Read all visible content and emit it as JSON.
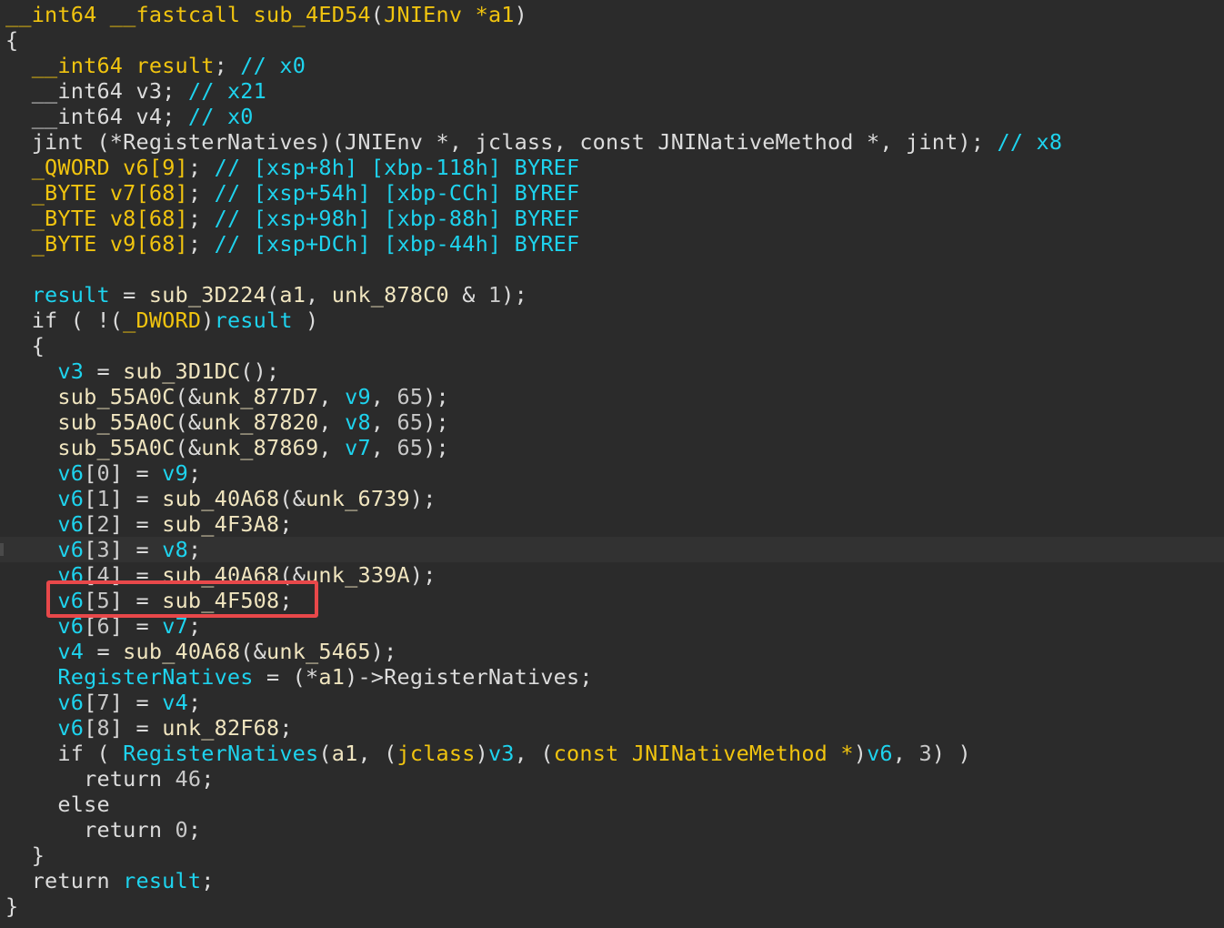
{
  "colors": {
    "background": "#2b2b2b",
    "type": "#f1c40f",
    "function": "#f0e5bf",
    "variable": "#1ed3ee",
    "comment": "#1ed3ee",
    "plain": "#dcdcdc",
    "number": "#c8c8c8",
    "highlight_box": "#e8484a"
  },
  "highlight": {
    "line_index": 23,
    "text": "v6[5] = sub_4F508;"
  },
  "code_lines": [
    {
      "indent": "",
      "tokens": [
        [
          "__int64",
          "type"
        ],
        [
          " ",
          "plain"
        ],
        [
          "__fastcall",
          "type"
        ],
        [
          " ",
          "plain"
        ],
        [
          "sub_4ED54",
          "type"
        ],
        [
          "(",
          "plain"
        ],
        [
          "JNIEnv",
          "type"
        ],
        [
          " ",
          "plain"
        ],
        [
          "*",
          "type"
        ],
        [
          "a1",
          "type"
        ],
        [
          ")",
          "plain"
        ]
      ]
    },
    {
      "indent": "",
      "tokens": [
        [
          "{",
          "plain"
        ]
      ]
    },
    {
      "indent": "  ",
      "tokens": [
        [
          "__int64",
          "type"
        ],
        [
          " ",
          "plain"
        ],
        [
          "result",
          "type"
        ],
        [
          ";",
          "plain"
        ],
        [
          " // x0",
          "comment"
        ]
      ]
    },
    {
      "indent": "  ",
      "tokens": [
        [
          "__int64",
          "plain"
        ],
        [
          " ",
          "plain"
        ],
        [
          "v3",
          "plain"
        ],
        [
          ";",
          "plain"
        ],
        [
          " // x21",
          "comment"
        ]
      ]
    },
    {
      "indent": "  ",
      "tokens": [
        [
          "__int64",
          "plain"
        ],
        [
          " ",
          "plain"
        ],
        [
          "v4",
          "plain"
        ],
        [
          ";",
          "plain"
        ],
        [
          " // x0",
          "comment"
        ]
      ]
    },
    {
      "indent": "  ",
      "tokens": [
        [
          "jint (*RegisterNatives)(JNIEnv *, jclass, const JNINativeMethod *, jint);",
          "plain"
        ],
        [
          " // x8",
          "comment"
        ]
      ]
    },
    {
      "indent": "  ",
      "tokens": [
        [
          "_QWORD",
          "type"
        ],
        [
          " ",
          "plain"
        ],
        [
          "v6[9]",
          "type"
        ],
        [
          ";",
          "plain"
        ],
        [
          " // [xsp+8h] [xbp-118h] BYREF",
          "comment"
        ]
      ]
    },
    {
      "indent": "  ",
      "tokens": [
        [
          "_BYTE",
          "type"
        ],
        [
          " ",
          "plain"
        ],
        [
          "v7[68]",
          "type"
        ],
        [
          ";",
          "plain"
        ],
        [
          " // [xsp+54h] [xbp-CCh] BYREF",
          "comment"
        ]
      ]
    },
    {
      "indent": "  ",
      "tokens": [
        [
          "_BYTE",
          "type"
        ],
        [
          " ",
          "plain"
        ],
        [
          "v8[68]",
          "type"
        ],
        [
          ";",
          "plain"
        ],
        [
          " // [xsp+98h] [xbp-88h] BYREF",
          "comment"
        ]
      ]
    },
    {
      "indent": "  ",
      "tokens": [
        [
          "_BYTE",
          "type"
        ],
        [
          " ",
          "plain"
        ],
        [
          "v9[68]",
          "type"
        ],
        [
          ";",
          "plain"
        ],
        [
          " // [xsp+DCh] [xbp-44h] BYREF",
          "comment"
        ]
      ]
    },
    {
      "indent": "",
      "tokens": []
    },
    {
      "indent": "  ",
      "tokens": [
        [
          "result",
          "variable"
        ],
        [
          " = ",
          "plain"
        ],
        [
          "sub_3D224",
          "function"
        ],
        [
          "(",
          "plain"
        ],
        [
          "a1",
          "function"
        ],
        [
          ", ",
          "plain"
        ],
        [
          "unk_878C0",
          "function"
        ],
        [
          " & ",
          "plain"
        ],
        [
          "1",
          "number"
        ],
        [
          ");",
          "plain"
        ]
      ]
    },
    {
      "indent": "  ",
      "tokens": [
        [
          "if ( !(",
          "plain"
        ],
        [
          "_DWORD",
          "type"
        ],
        [
          ")",
          "plain"
        ],
        [
          "result",
          "variable"
        ],
        [
          " )",
          "plain"
        ]
      ]
    },
    {
      "indent": "  ",
      "tokens": [
        [
          "{",
          "plain"
        ]
      ]
    },
    {
      "indent": "    ",
      "tokens": [
        [
          "v3",
          "variable"
        ],
        [
          " = ",
          "plain"
        ],
        [
          "sub_3D1DC",
          "function"
        ],
        [
          "();",
          "plain"
        ]
      ]
    },
    {
      "indent": "    ",
      "tokens": [
        [
          "sub_55A0C",
          "function"
        ],
        [
          "(&",
          "plain"
        ],
        [
          "unk_877D7",
          "function"
        ],
        [
          ", ",
          "plain"
        ],
        [
          "v9",
          "variable"
        ],
        [
          ", ",
          "plain"
        ],
        [
          "65",
          "number"
        ],
        [
          ");",
          "plain"
        ]
      ]
    },
    {
      "indent": "    ",
      "tokens": [
        [
          "sub_55A0C",
          "function"
        ],
        [
          "(&",
          "plain"
        ],
        [
          "unk_87820",
          "function"
        ],
        [
          ", ",
          "plain"
        ],
        [
          "v8",
          "variable"
        ],
        [
          ", ",
          "plain"
        ],
        [
          "65",
          "number"
        ],
        [
          ");",
          "plain"
        ]
      ]
    },
    {
      "indent": "    ",
      "tokens": [
        [
          "sub_55A0C",
          "function"
        ],
        [
          "(&",
          "plain"
        ],
        [
          "unk_87869",
          "function"
        ],
        [
          ", ",
          "plain"
        ],
        [
          "v7",
          "variable"
        ],
        [
          ", ",
          "plain"
        ],
        [
          "65",
          "number"
        ],
        [
          ");",
          "plain"
        ]
      ]
    },
    {
      "indent": "    ",
      "tokens": [
        [
          "v6",
          "variable"
        ],
        [
          "[",
          "plain"
        ],
        [
          "0",
          "number"
        ],
        [
          "] = ",
          "plain"
        ],
        [
          "v9",
          "variable"
        ],
        [
          ";",
          "plain"
        ]
      ]
    },
    {
      "indent": "    ",
      "tokens": [
        [
          "v6",
          "variable"
        ],
        [
          "[",
          "plain"
        ],
        [
          "1",
          "number"
        ],
        [
          "] = ",
          "plain"
        ],
        [
          "sub_40A68",
          "function"
        ],
        [
          "(&",
          "plain"
        ],
        [
          "unk_6739",
          "function"
        ],
        [
          ");",
          "plain"
        ]
      ]
    },
    {
      "indent": "    ",
      "tokens": [
        [
          "v6",
          "variable"
        ],
        [
          "[",
          "plain"
        ],
        [
          "2",
          "number"
        ],
        [
          "] = ",
          "plain"
        ],
        [
          "sub_4F3A8",
          "function"
        ],
        [
          ";",
          "plain"
        ]
      ]
    },
    {
      "indent": "    ",
      "tokens": [
        [
          "v6",
          "variable"
        ],
        [
          "[",
          "plain"
        ],
        [
          "3",
          "number"
        ],
        [
          "] = ",
          "plain"
        ],
        [
          "v8",
          "variable"
        ],
        [
          ";",
          "plain"
        ]
      ]
    },
    {
      "indent": "    ",
      "tokens": [
        [
          "v6",
          "variable"
        ],
        [
          "[",
          "plain"
        ],
        [
          "4",
          "number"
        ],
        [
          "] = ",
          "plain"
        ],
        [
          "sub_40A68",
          "function"
        ],
        [
          "(&",
          "plain"
        ],
        [
          "unk_339A",
          "function"
        ],
        [
          ");",
          "plain"
        ]
      ]
    },
    {
      "indent": "    ",
      "tokens": [
        [
          "v6",
          "variable"
        ],
        [
          "[",
          "plain"
        ],
        [
          "5",
          "number"
        ],
        [
          "] = ",
          "plain"
        ],
        [
          "sub_4F508",
          "function"
        ],
        [
          ";",
          "plain"
        ]
      ]
    },
    {
      "indent": "    ",
      "tokens": [
        [
          "v6",
          "variable"
        ],
        [
          "[",
          "plain"
        ],
        [
          "6",
          "number"
        ],
        [
          "] = ",
          "plain"
        ],
        [
          "v7",
          "variable"
        ],
        [
          ";",
          "plain"
        ]
      ]
    },
    {
      "indent": "    ",
      "tokens": [
        [
          "v4",
          "variable"
        ],
        [
          " = ",
          "plain"
        ],
        [
          "sub_40A68",
          "function"
        ],
        [
          "(&",
          "plain"
        ],
        [
          "unk_5465",
          "function"
        ],
        [
          ");",
          "plain"
        ]
      ]
    },
    {
      "indent": "    ",
      "tokens": [
        [
          "RegisterNatives",
          "variable"
        ],
        [
          " = (*",
          "plain"
        ],
        [
          "a1",
          "function"
        ],
        [
          ")->RegisterNatives;",
          "plain"
        ]
      ]
    },
    {
      "indent": "    ",
      "tokens": [
        [
          "v6",
          "variable"
        ],
        [
          "[",
          "plain"
        ],
        [
          "7",
          "number"
        ],
        [
          "] = ",
          "plain"
        ],
        [
          "v4",
          "variable"
        ],
        [
          ";",
          "plain"
        ]
      ]
    },
    {
      "indent": "    ",
      "tokens": [
        [
          "v6",
          "variable"
        ],
        [
          "[",
          "plain"
        ],
        [
          "8",
          "number"
        ],
        [
          "] = ",
          "plain"
        ],
        [
          "unk_82F68",
          "function"
        ],
        [
          ";",
          "plain"
        ]
      ]
    },
    {
      "indent": "    ",
      "tokens": [
        [
          "if ( ",
          "plain"
        ],
        [
          "RegisterNatives",
          "variable"
        ],
        [
          "(",
          "plain"
        ],
        [
          "a1",
          "function"
        ],
        [
          ", (",
          "plain"
        ],
        [
          "jclass",
          "type"
        ],
        [
          ")",
          "plain"
        ],
        [
          "v3",
          "variable"
        ],
        [
          ", (",
          "plain"
        ],
        [
          "const JNINativeMethod *",
          "type"
        ],
        [
          ")",
          "plain"
        ],
        [
          "v6",
          "variable"
        ],
        [
          ", ",
          "plain"
        ],
        [
          "3",
          "number"
        ],
        [
          ") )",
          "plain"
        ]
      ]
    },
    {
      "indent": "      ",
      "tokens": [
        [
          "return ",
          "plain"
        ],
        [
          "46",
          "number"
        ],
        [
          ";",
          "plain"
        ]
      ]
    },
    {
      "indent": "    ",
      "tokens": [
        [
          "else",
          "plain"
        ]
      ]
    },
    {
      "indent": "      ",
      "tokens": [
        [
          "return ",
          "plain"
        ],
        [
          "0",
          "number"
        ],
        [
          ";",
          "plain"
        ]
      ]
    },
    {
      "indent": "  ",
      "tokens": [
        [
          "}",
          "plain"
        ]
      ]
    },
    {
      "indent": "  ",
      "tokens": [
        [
          "return ",
          "plain"
        ],
        [
          "result",
          "variable"
        ],
        [
          ";",
          "plain"
        ]
      ]
    },
    {
      "indent": "",
      "tokens": [
        [
          "}",
          "plain"
        ]
      ]
    }
  ]
}
